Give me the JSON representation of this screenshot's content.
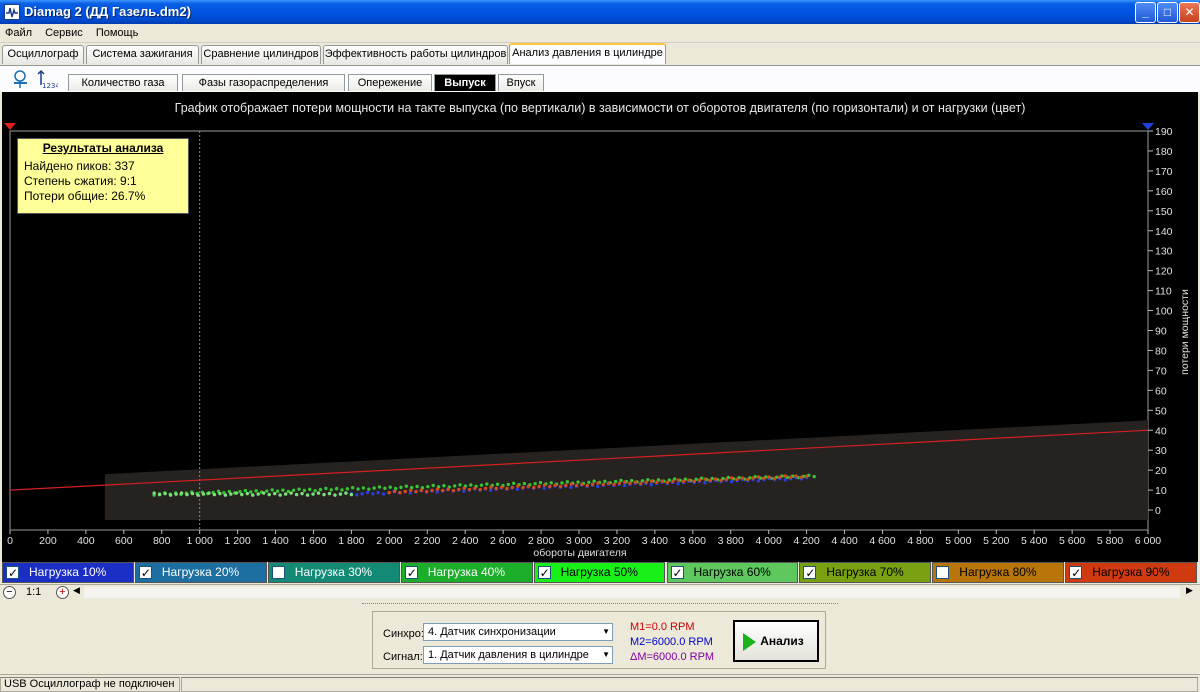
{
  "window": {
    "title": "Diamag 2 (ДД Газель.dm2)",
    "min": "_",
    "max": "□",
    "close": "✕"
  },
  "menu": [
    "Файл",
    "Сервис",
    "Помощь"
  ],
  "main_tabs": [
    "Осциллограф",
    "Система зажигания",
    "Сравнение цилиндров",
    "Эффективность работы цилиндров",
    "Анализ давления в цилиндре"
  ],
  "sub_tabs": [
    "Количество газа",
    "Фазы газораспределения",
    "Опережение",
    "Выпуск",
    "Впуск"
  ],
  "active_main_tab": 4,
  "active_sub_tab": 3,
  "chart_data": {
    "type": "scatter",
    "title": "График отображает потери мощности на такте выпуска (по вертикали) в зависимости от оборотов двигателя (по горизонтали) и от нагрузки (цвет)",
    "xlabel": "обороты двигателя",
    "ylabel": "потери мощности",
    "xlim": [
      0,
      6000
    ],
    "ylim": [
      -10,
      190
    ],
    "x_ticks": [
      "0",
      "200",
      "400",
      "600",
      "800",
      "1 000",
      "1 200",
      "1 400",
      "1 600",
      "1 800",
      "2 000",
      "2 200",
      "2 400",
      "2 600",
      "2 800",
      "3 000",
      "3 200",
      "3 400",
      "3 600",
      "3 800",
      "4 000",
      "4 200",
      "4 400",
      "4 600",
      "4 800",
      "5 000",
      "5 200",
      "5 400",
      "5 600",
      "5 800",
      "6 000"
    ],
    "y_ticks": [
      "0",
      "10",
      "20",
      "30",
      "40",
      "50",
      "60",
      "70",
      "80",
      "90",
      "100",
      "110",
      "120",
      "130",
      "140",
      "150",
      "160",
      "170",
      "180",
      "190"
    ],
    "cursor_x": 1000,
    "trend_line": {
      "x": [
        0,
        6000
      ],
      "y": [
        10,
        40
      ],
      "color": "#d42020"
    },
    "band": {
      "x": [
        500,
        6000
      ],
      "y_low": [
        -5,
        -5
      ],
      "y_high": [
        18,
        45
      ],
      "color": "#262220"
    },
    "series": [
      {
        "name": "Нагрузка 40%",
        "color": "#35c435",
        "x": [
          760,
          4240
        ],
        "y": [
          8,
          17
        ]
      },
      {
        "name": "Нагрузка 10%",
        "color": "#2a3fd8",
        "x": [
          1800,
          4200
        ],
        "y": [
          8,
          16
        ]
      },
      {
        "name": "Нагрузка 90%",
        "color": "#d04a20",
        "x": [
          2000,
          4200
        ],
        "y": [
          9,
          17
        ]
      },
      {
        "name": "Нагрузка 50%",
        "color": "#7de07d",
        "x": [
          760,
          1800
        ],
        "y": [
          8,
          8
        ]
      }
    ]
  },
  "results": {
    "title": "Результаты анализа",
    "peaks": "Найдено пиков: 337",
    "compression": "Степень сжатия: 9:1",
    "losses": "Потери общие: 26.7%"
  },
  "legend": [
    {
      "label": "Нагрузка 10%",
      "checked": true,
      "color": "#1c2fc4",
      "text": "#ffffff"
    },
    {
      "label": "Нагрузка 20%",
      "checked": true,
      "color": "#1c6fa0",
      "text": "#ffffff"
    },
    {
      "label": "Нагрузка 30%",
      "checked": false,
      "color": "#138a74",
      "text": "#ffffff"
    },
    {
      "label": "Нагрузка 40%",
      "checked": true,
      "color": "#1aae2a",
      "text": "#ffffff"
    },
    {
      "label": "Нагрузка 50%",
      "checked": true,
      "color": "#18f018",
      "text": "#000000"
    },
    {
      "label": "Нагрузка 60%",
      "checked": true,
      "color": "#5ec85e",
      "text": "#000000"
    },
    {
      "label": "Нагрузка 70%",
      "checked": true,
      "color": "#78a010",
      "text": "#000000"
    },
    {
      "label": "Нагрузка 80%",
      "checked": false,
      "color": "#b8760a",
      "text": "#000000"
    },
    {
      "label": "Нагрузка 90%",
      "checked": true,
      "color": "#d03a10",
      "text": "#000000"
    }
  ],
  "zoom": "1:1",
  "controls": {
    "sync_label": "Синхро:",
    "sync_value": "4.  Датчик синхронизации",
    "signal_label": "Сигнал:",
    "signal_value": "1.  Датчик давления в цилиндре",
    "m1": "M1=0.0 RPM",
    "m2": "M2=6000.0 RPM",
    "dm": "ΔM=6000.0 RPM",
    "analyze": "Анализ"
  },
  "status": {
    "usb": "USB Осциллограф не подключен"
  },
  "colors": {
    "m1": "#cc0000",
    "m2": "#0000cc",
    "dm": "#8000a0"
  }
}
